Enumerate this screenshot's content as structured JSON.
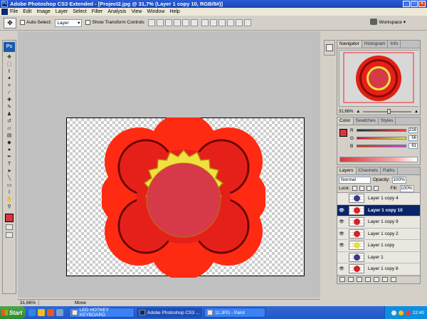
{
  "window": {
    "title": "Adobe Photoshop CS3 Extended - [Project2.jpg @ 31,7% (Layer 1 copy 10, RGB/8#)]",
    "app_icon": "Ps",
    "controls": [
      "_",
      "□",
      "x"
    ]
  },
  "menu": {
    "items": [
      "File",
      "Edit",
      "Image",
      "Layer",
      "Select",
      "Filter",
      "Analysis",
      "View",
      "Window",
      "Help"
    ]
  },
  "options": {
    "auto_select_label": "Auto-Select:",
    "auto_select_value": "Layer",
    "show_transform_label": "Show Transform Controls",
    "workspace_label": "Workspace ▾"
  },
  "toolbox": {
    "logo": "Ps",
    "tools": [
      "move-tool-icon",
      "marquee-tool-icon",
      "lasso-tool-icon",
      "magic-wand-tool-icon",
      "crop-tool-icon",
      "eyedropper-tool-icon",
      "healing-brush-icon",
      "brush-tool-icon",
      "clone-stamp-icon",
      "history-brush-icon",
      "eraser-tool-icon",
      "gradient-tool-icon",
      "blur-tool-icon",
      "dodge-tool-icon",
      "pen-tool-icon",
      "type-tool-icon",
      "path-selection-icon",
      "shape-tool-icon",
      "notes-tool-icon",
      "eyedropper2-tool-icon",
      "hand-tool-icon",
      "zoom-tool-icon"
    ],
    "foreground_color": "#d4383f"
  },
  "status": {
    "zoom": "31,66%",
    "text": "Move"
  },
  "navigator": {
    "tabs": [
      "Navigator",
      "Histogram",
      "Info"
    ],
    "zoom": "31,66%"
  },
  "color": {
    "tabs": [
      "Color",
      "Swatches",
      "Styles"
    ],
    "r": "216",
    "g": "56",
    "b": "61",
    "labels": [
      "R",
      "G",
      "B"
    ],
    "fg": "#d8383d"
  },
  "layers": {
    "tabs": [
      "Layers",
      "Channels",
      "Paths"
    ],
    "blend_mode": "Normal",
    "opacity_label": "Opacity:",
    "opacity": "100%",
    "lock_label": "Lock:",
    "fill_label": "Fill:",
    "fill": "100%",
    "rows": [
      {
        "name": "Layer 1 copy 4",
        "visible": false,
        "selected": false,
        "thumb": "#3a3a8c"
      },
      {
        "name": "Layer 1 copy 10",
        "visible": true,
        "selected": true,
        "thumb": "#d82020"
      },
      {
        "name": "Layer 1 copy 9",
        "visible": true,
        "selected": false,
        "thumb": "#d82020"
      },
      {
        "name": "Layer 1 copy 2",
        "visible": true,
        "selected": false,
        "thumb": "#d82020"
      },
      {
        "name": "Layer 1 copy",
        "visible": true,
        "selected": false,
        "thumb": "#e8e040"
      },
      {
        "name": "Layer 1",
        "visible": false,
        "selected": false,
        "thumb": "#3a3a8c"
      },
      {
        "name": "Layer 1 copy 8",
        "visible": true,
        "selected": false,
        "thumb": "#d82020"
      }
    ]
  },
  "taskbar": {
    "start_label": "Start",
    "tasks": [
      {
        "label": "LED HOTKEY KEYBOARD",
        "active": false
      },
      {
        "label": "Adobe Photoshop CS3 ...",
        "active": true
      },
      {
        "label": "11.JPG - Paint",
        "active": false
      }
    ],
    "clock": "22:40"
  }
}
